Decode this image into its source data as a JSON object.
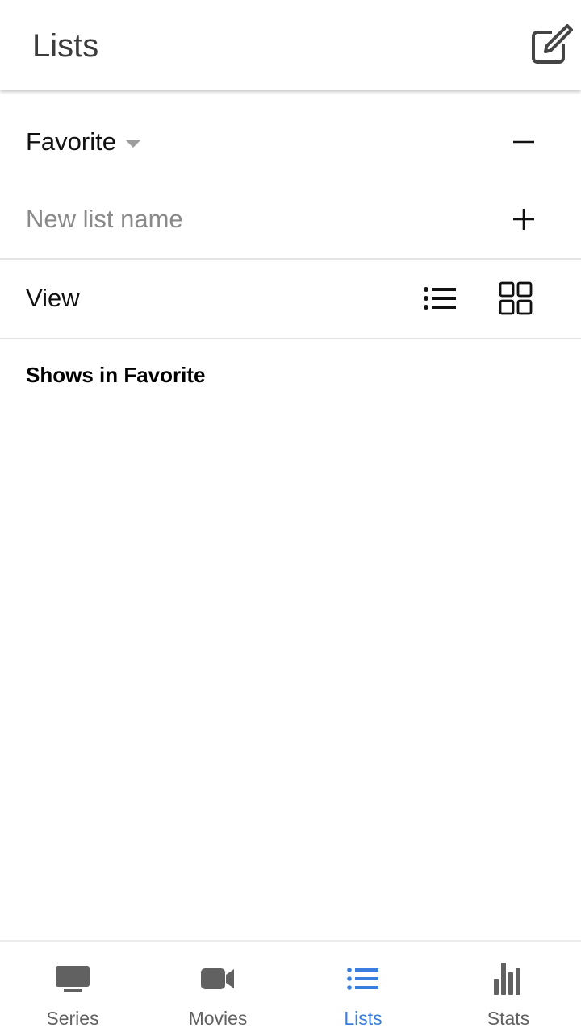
{
  "appbar": {
    "title": "Lists",
    "edit_icon": "edit-square-icon"
  },
  "list_selector": {
    "selected": "Favorite",
    "caret_icon": "dropdown-caret-icon",
    "remove_icon": "minus-icon"
  },
  "new_list": {
    "placeholder": "New list name",
    "value": "",
    "add_icon": "plus-icon"
  },
  "view": {
    "label": "View",
    "list_icon": "list-view-icon",
    "grid_icon": "grid-view-icon"
  },
  "section": {
    "title": "Shows in Favorite"
  },
  "bottom_nav": {
    "items": [
      {
        "label": "Series",
        "icon": "tv-icon",
        "active": false
      },
      {
        "label": "Movies",
        "icon": "video-camera-icon",
        "active": false
      },
      {
        "label": "Lists",
        "icon": "list-icon",
        "active": true
      },
      {
        "label": "Stats",
        "icon": "bar-chart-icon",
        "active": false
      }
    ]
  },
  "colors": {
    "active": "#3b7ddd",
    "inactive": "#616161",
    "divider": "#e3e3e3",
    "placeholder": "#8a8a8a",
    "caret": "#9e9e9e"
  }
}
